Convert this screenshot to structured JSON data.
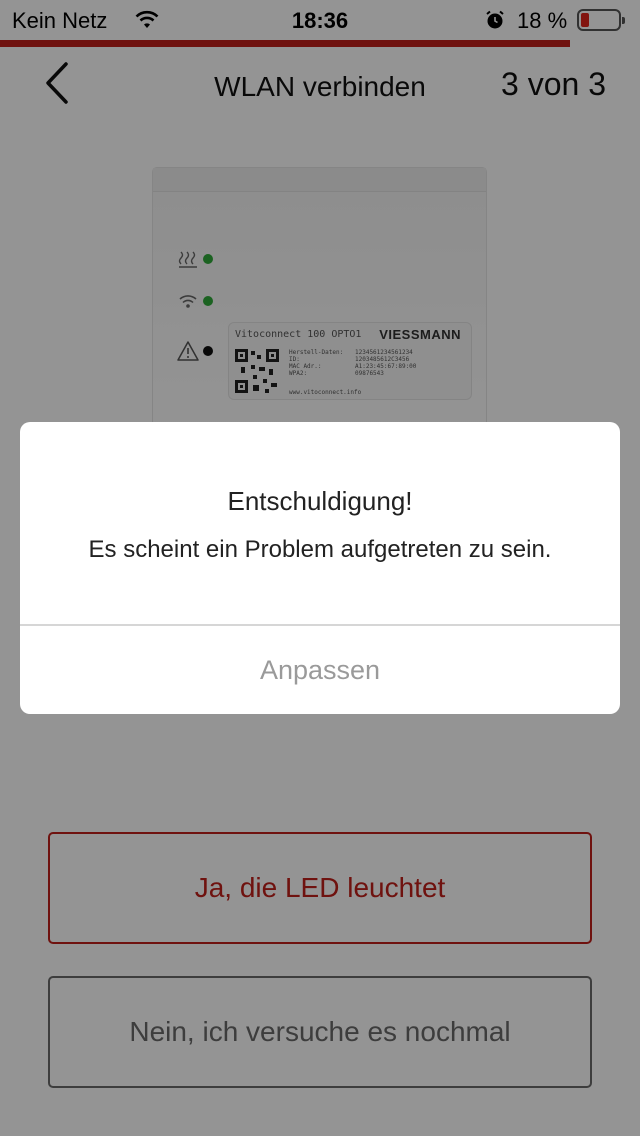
{
  "status_bar": {
    "carrier": "Kein Netz",
    "time": "18:36",
    "battery_percent": "18 %",
    "battery_color": "#e0241b"
  },
  "header": {
    "title": "WLAN verbinden",
    "step": "3 von 3",
    "progress_fraction": 0.89,
    "accent_color": "#c0201a"
  },
  "device": {
    "model": "Vitoconnect 100 OPTO1",
    "brand": "VIESSMANN",
    "label_lines": [
      {
        "key": "Herstell-Daten:",
        "value": "1234561234561234"
      },
      {
        "key": "ID:",
        "value": "1203485612C3456"
      },
      {
        "key": "MAC Adr.:",
        "value": "A1:23:45:67:89:00"
      },
      {
        "key": "WPA2:",
        "value": "09876543"
      }
    ],
    "url": "www.vitoconnect.info",
    "leds": [
      {
        "icon": "heating-icon",
        "state": "green"
      },
      {
        "icon": "wifi-icon",
        "state": "green"
      },
      {
        "icon": "warning-icon",
        "state": "black"
      }
    ]
  },
  "dialog": {
    "title": "Entschuldigung!",
    "message": "Es scheint ein Problem aufgetreten zu sein.",
    "action": "Anpassen"
  },
  "actions": {
    "yes_label": "Ja, die LED leuchtet",
    "no_label": "Nein, ich versuche es nochmal"
  }
}
